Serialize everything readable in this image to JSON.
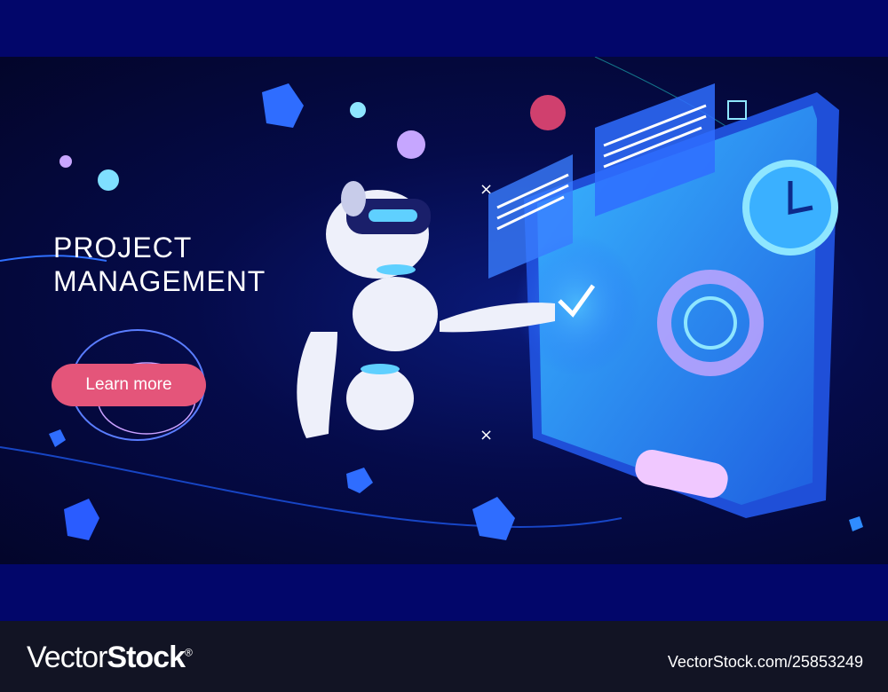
{
  "hero": {
    "title_line1": "PROJECT",
    "title_line2": "MANAGEMENT",
    "cta_label": "Learn more"
  },
  "footer": {
    "logo_regular": "Vector",
    "logo_bold": "Stock",
    "logo_mark": "®",
    "image_ref": "VectorStock.com/25853249"
  },
  "colors": {
    "band": "#02066a",
    "background": "#050b4a",
    "cta": "#e4557a",
    "screen": "#2f8cff",
    "footer": "#121424"
  }
}
